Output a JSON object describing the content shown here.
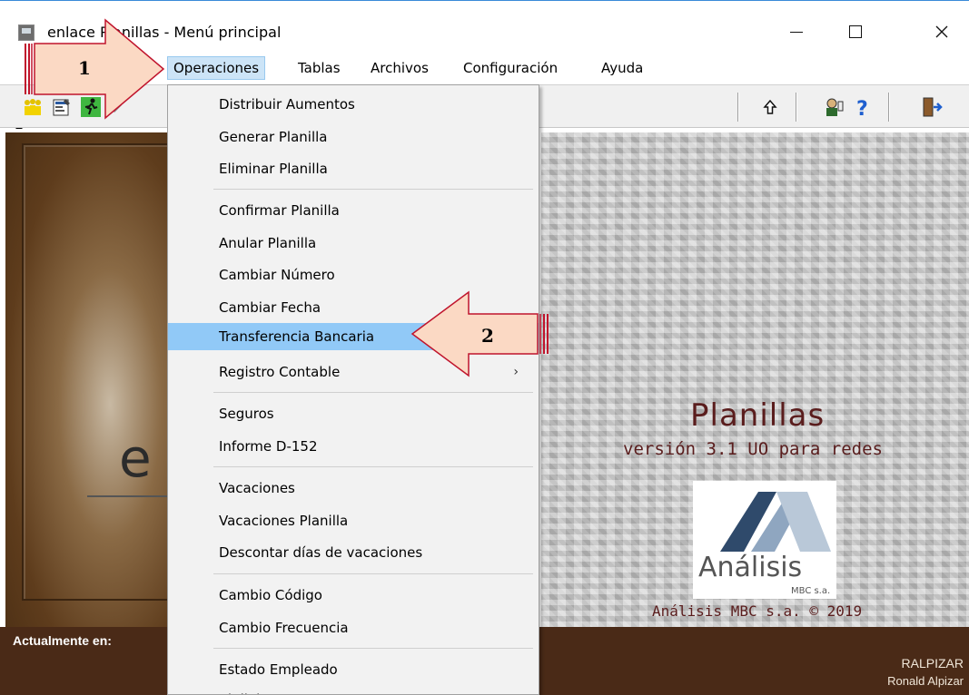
{
  "window": {
    "title": "enlace Planillas - Menú principal",
    "controls": {
      "minimize": "minimize-icon",
      "maximize": "maximize-icon",
      "close": "close-icon"
    }
  },
  "menubar": {
    "items": [
      {
        "label": "Operaciones",
        "active": true
      },
      {
        "label": "Tablas"
      },
      {
        "label": "Archivos"
      },
      {
        "label": "Configuración"
      },
      {
        "label": "Ayuda"
      }
    ],
    "partial_left": "E"
  },
  "toolbar": {
    "icons": [
      "employees-icon",
      "report-icon",
      "runner-icon",
      "eraser-icon",
      "up-arrow-icon",
      "user-help-icon",
      "question-icon",
      "exit-door-icon"
    ]
  },
  "dropdown": {
    "items": [
      {
        "label": "Distribuir Aumentos"
      },
      {
        "label": "Generar Planilla"
      },
      {
        "label": "Eliminar Planilla"
      },
      {
        "label": "Confirmar Planilla"
      },
      {
        "label": "Anular Planilla"
      },
      {
        "label": "Cambiar Número"
      },
      {
        "label": "Cambiar Fecha"
      },
      {
        "label": "Transferencia Bancaria",
        "highlighted": true
      },
      {
        "label": "Registro Contable",
        "submenu": "›"
      },
      {
        "label": "Seguros"
      },
      {
        "label": "Informe D-152"
      },
      {
        "label": "Vacaciones"
      },
      {
        "label": "Vacaciones Planilla"
      },
      {
        "label": "Descontar días de vacaciones"
      },
      {
        "label": "Cambio Código"
      },
      {
        "label": "Cambio Frecuencia"
      },
      {
        "label": "Estado Empleado"
      },
      {
        "label": "Vigilalcancc"
      }
    ]
  },
  "splash": {
    "left_logo_letter": "e",
    "product_title": "Planillas",
    "product_version": "versión 3.1 UO para redes",
    "logo_name": "Análisis",
    "logo_sub": "MBC s.a.",
    "copyright": "Análisis MBC s.a. © 2019",
    "logo_colors": {
      "dark": "#2f4a6b",
      "light": "#8fa6c0"
    }
  },
  "status": {
    "label": "Actualmente en:",
    "user_code": "RALPIZAR",
    "user_name": "Ronald Alpizar"
  },
  "annotations": {
    "arrow1_label": "1",
    "arrow2_label": "2",
    "arrow_fill": "#fbd9c4",
    "arrow_stroke": "#c0142c"
  }
}
